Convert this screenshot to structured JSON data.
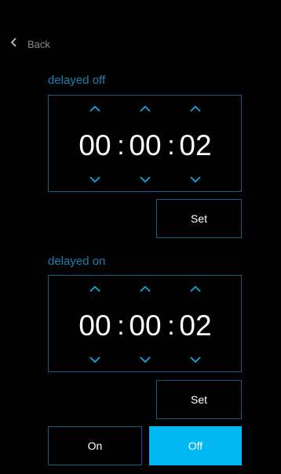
{
  "back": {
    "label": "Back",
    "icon": "chevron-left-icon"
  },
  "colors": {
    "accent": "#00b7f1",
    "frame_border": "#135e86",
    "title": "#1a80b3",
    "back_text": "#8c8c8c"
  },
  "delayed_off": {
    "title": "delayed off",
    "hours": "00",
    "minutes": "00",
    "seconds": "02",
    "set_label": "Set"
  },
  "delayed_on": {
    "title": "delayed on",
    "hours": "00",
    "minutes": "00",
    "seconds": "02",
    "set_label": "Set"
  },
  "actions": {
    "on_label": "On",
    "off_label": "Off",
    "selected": "Off"
  },
  "icons": {
    "increment": "chevron-up-icon",
    "decrement": "chevron-down-icon"
  }
}
